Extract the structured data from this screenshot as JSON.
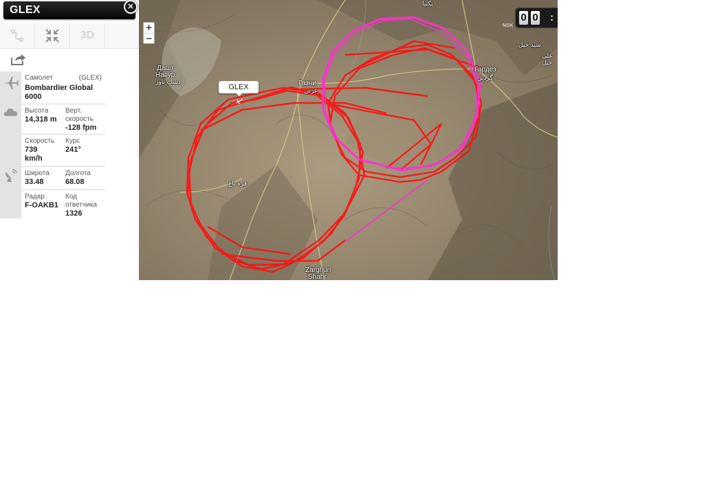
{
  "flight": {
    "callsign": "GLEX",
    "aircraft_label": "Самолет",
    "aircraft_code": "(GLEX)",
    "aircraft_name": "Bombardier Global 6000",
    "altitude_label": "Высота",
    "altitude_value": "14,318 m",
    "vspeed_label": "Верт. скорость",
    "vspeed_value": "-128 fpm",
    "speed_label": "Скорость",
    "speed_value": "739 km/h",
    "heading_label": "Курс",
    "heading_value": "241°",
    "lat_label": "Широта",
    "lat_value": "33.48",
    "lon_label": "Долгота",
    "lon_value": "68.08",
    "radar_label": "Радар",
    "radar_value": "F-OAKB1",
    "squawk_label": "Код ответчика",
    "squawk_value": "1326"
  },
  "toolbar": {
    "route_icon": "route-icon",
    "center_icon": "collapse-arrows-icon",
    "threed_label": "3D",
    "share_icon": "share-icon"
  },
  "map": {
    "zoom_in_label": "+",
    "zoom_out_label": "−",
    "flight_label": "GLEX",
    "clock_digits": [
      "0",
      "0"
    ],
    "clock_separator": ":",
    "timezone": "MSK",
    "places": {
      "dasht_ru": "Дашт",
      "navur_ru": "Навур",
      "navur_fa": "دشت ناور",
      "ghazni_ru": "Газни",
      "ghazni_fa": "غزنی",
      "gardez_ru": "Гардез",
      "gardez_fa": "گردیز",
      "qarabagh_fa": "قره باغ",
      "zarghun_en": "Zarghun",
      "shahr_en": "Shahr",
      "sayed_fa": "سید خیل",
      "ali_fa": "علی خیل",
      "paktia_fa": "پکتیا"
    }
  },
  "colors": {
    "track_red": "#ff1010",
    "track_magenta": "#ff2fd0",
    "panel_header": "#111111"
  }
}
